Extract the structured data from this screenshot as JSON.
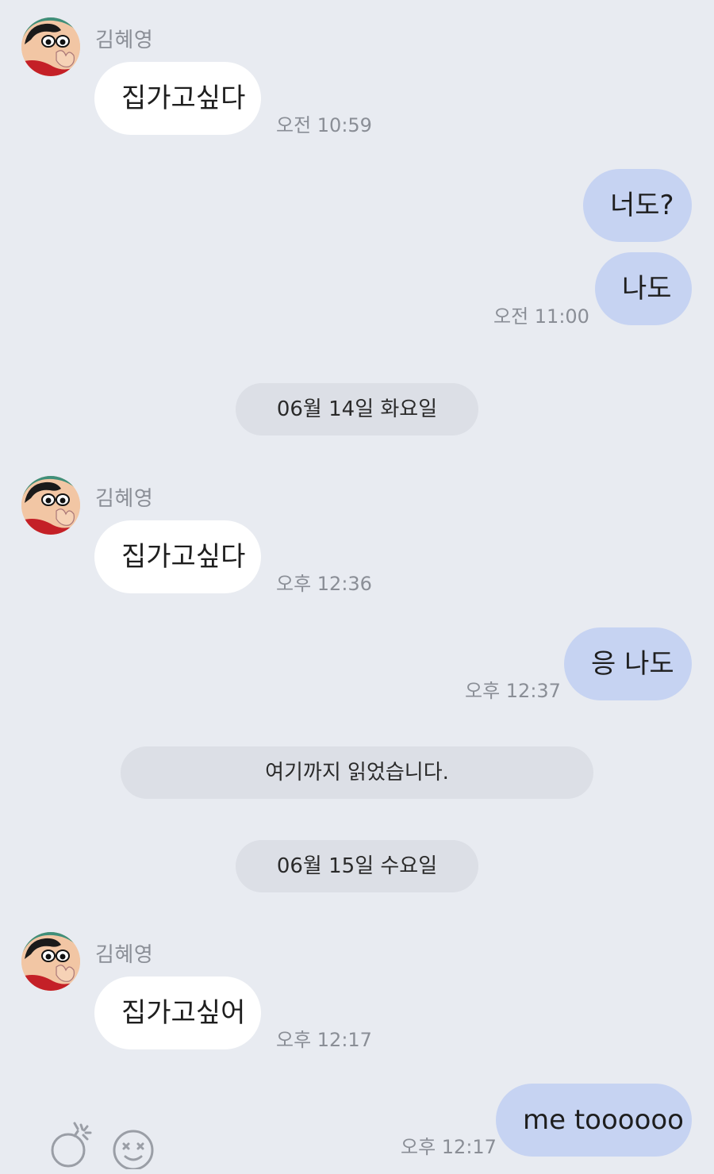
{
  "sender_name": "김혜영",
  "messages": [
    {
      "type": "in",
      "text": "집가고싶다",
      "time": "오전 10:59"
    },
    {
      "type": "out",
      "text": "너도?"
    },
    {
      "type": "out",
      "text": "나도",
      "time": "오전 11:00"
    },
    {
      "type": "date",
      "text": "06월 14일 화요일"
    },
    {
      "type": "in",
      "text": "집가고싶다",
      "time": "오후 12:36"
    },
    {
      "type": "out",
      "text": "응 나도",
      "time": "오후 12:37"
    },
    {
      "type": "read_marker",
      "text": "여기까지 읽었습니다."
    },
    {
      "type": "date",
      "text": "06월 15일 수요일"
    },
    {
      "type": "in",
      "text": "집가고싶어",
      "time": "오후 12:17"
    },
    {
      "type": "out",
      "text": "me toooooo",
      "time": "오후 12:17"
    }
  ],
  "bottom_icons": [
    "bomb-icon",
    "dizzy-emoji-icon"
  ],
  "colors": {
    "background": "#e8ebf1",
    "incoming": "#ffffff",
    "outgoing": "#c6d3f2",
    "divider": "#dcdfe6",
    "meta_text": "#8a8e96"
  }
}
